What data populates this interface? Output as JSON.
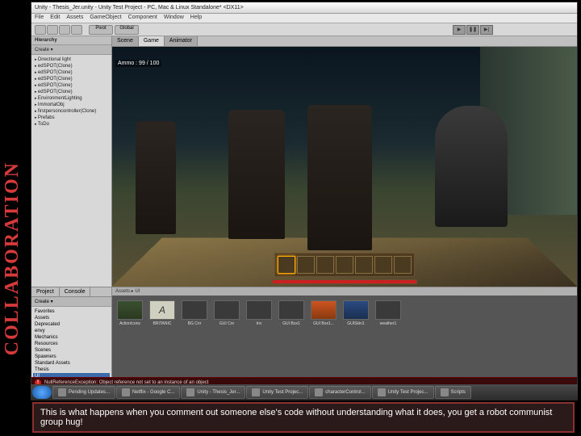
{
  "slide": {
    "sidebar_label": "COLLABORATION",
    "caption": "This is what happens when you comment out someone else's code without understanding what it does, you get a robot communist group hug!"
  },
  "unity": {
    "title": "Unity - Thesis_Jer.unity - Unity Test Project - PC, Mac & Linux Standalone* <DX11>",
    "menu": [
      "File",
      "Edit",
      "Assets",
      "GameObject",
      "Component",
      "Window",
      "Help"
    ],
    "toolbar": {
      "pivot": "Pivot",
      "global": "Global"
    },
    "hierarchy": {
      "tab": "Hierarchy",
      "create": "Create ▾",
      "items": [
        "Directional light",
        "edSPOT(Clone)",
        "edSPOT(Clone)",
        "edSPOT(Clone)",
        "edSPOT(Clone)",
        "edSPOT(Clone)",
        "EnvironmentLighting",
        "ImmortalObj",
        "firstpersoncontroller(Clone)",
        "Prefabs",
        "ToDo"
      ]
    },
    "gameview": {
      "tabs": [
        "Scene",
        "Game",
        "Animator"
      ],
      "ammo": "Ammo : 99 / 100"
    },
    "project": {
      "tabs": [
        "Project",
        "Console"
      ],
      "tree_header": "Create ▾",
      "tree": [
        "Favorites",
        "Assets",
        "Deprecated",
        "envy",
        "Mechanics",
        "Resources",
        "Scenes",
        "Spawners",
        "Standard Assets",
        "Thesis",
        "UI"
      ],
      "breadcrumb": "Assets ▸ UI",
      "assets": [
        {
          "name": "ActionIcons",
          "cls": "green"
        },
        {
          "name": "BRITANIC",
          "cls": "light",
          "glyph": "A"
        },
        {
          "name": "BG Cnr",
          "cls": "dark"
        },
        {
          "name": "GUI Cnr",
          "cls": "dark"
        },
        {
          "name": "Inv",
          "cls": "dark"
        },
        {
          "name": "GUI Box1",
          "cls": "dark"
        },
        {
          "name": "GUI Box1...",
          "cls": "orange"
        },
        {
          "name": "GUISkin1",
          "cls": "blue"
        },
        {
          "name": "weather1",
          "cls": "dark"
        }
      ]
    },
    "error": "NullReferenceException: Object reference not set to an instance of an object"
  },
  "taskbar": {
    "items": [
      "Pending Updates...",
      "Netflix - Google C...",
      "Unity - Thesis_Jer...",
      "Unity Test Projec...",
      "characterControl...",
      "Unity Test Projec...",
      "Scripts"
    ]
  }
}
